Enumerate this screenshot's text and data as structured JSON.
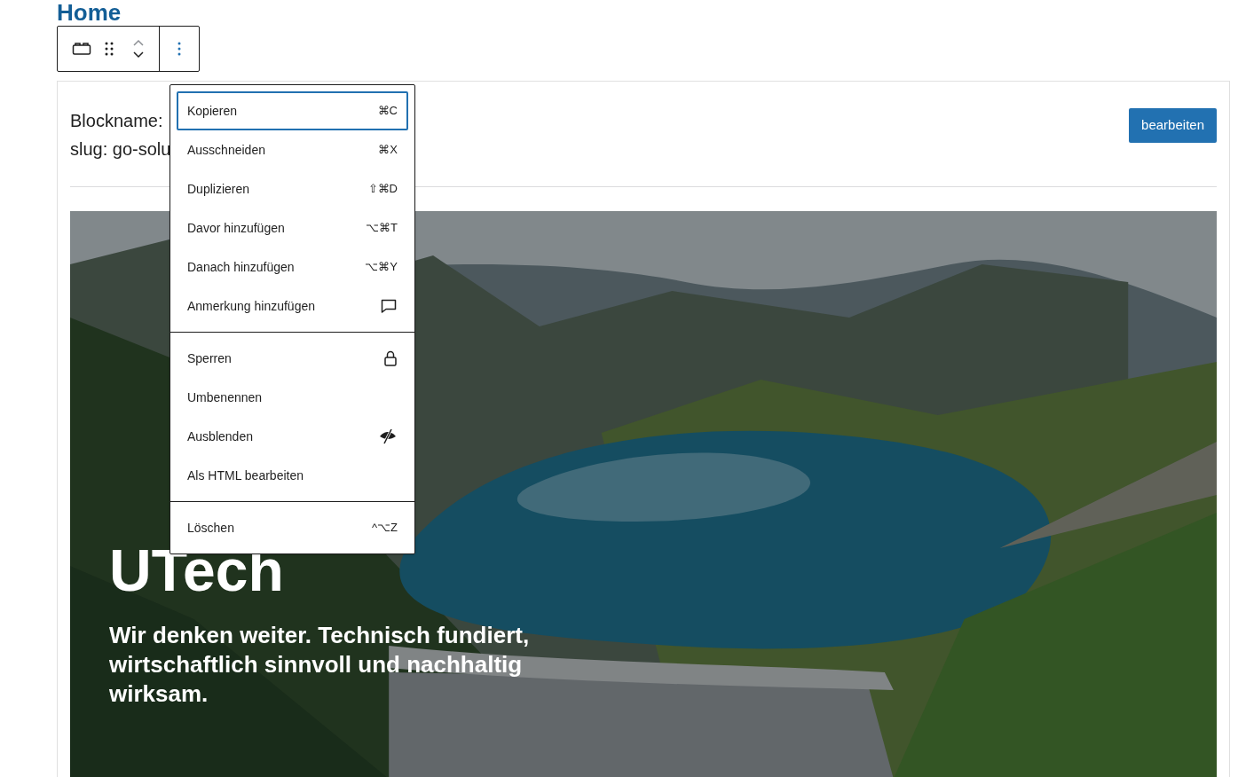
{
  "page_title": "Home",
  "toolbar": {
    "more_options_active": true
  },
  "block": {
    "info_lines": [
      "Blockname:",
      "slug: go-solu"
    ],
    "edit_button": "bearbeiten"
  },
  "hero": {
    "kind": "picture",
    "heading": "UTech",
    "tagline": "Wir denken weiter. Technisch fundiert, wirtschaftlich sinnvoll und nachhaltig wirksam."
  },
  "menu": {
    "groups": [
      [
        {
          "label": "Kopieren",
          "shortcut": "⌘C",
          "focused": true
        },
        {
          "label": "Ausschneiden",
          "shortcut": "⌘X",
          "focused": false
        },
        {
          "label": "Duplizieren",
          "shortcut": "⇧⌘D",
          "focused": false
        },
        {
          "label": "Davor hinzufügen",
          "shortcut": "⌥⌘T",
          "focused": false
        },
        {
          "label": "Danach hinzufügen",
          "shortcut": "⌥⌘Y",
          "focused": false
        },
        {
          "label": "Anmerkung hinzufügen",
          "kind": "comment",
          "focused": false
        }
      ],
      [
        {
          "label": "Sperren",
          "kind": "lock",
          "focused": false
        },
        {
          "label": "Umbenennen",
          "kind": "plain",
          "focused": false
        },
        {
          "label": "Ausblenden",
          "kind": "hidden",
          "focused": false
        },
        {
          "label": "Als HTML bearbeiten",
          "kind": "plain",
          "focused": false
        }
      ],
      [
        {
          "label": "Löschen",
          "shortcut": "^⌥Z",
          "focused": false
        }
      ]
    ]
  }
}
